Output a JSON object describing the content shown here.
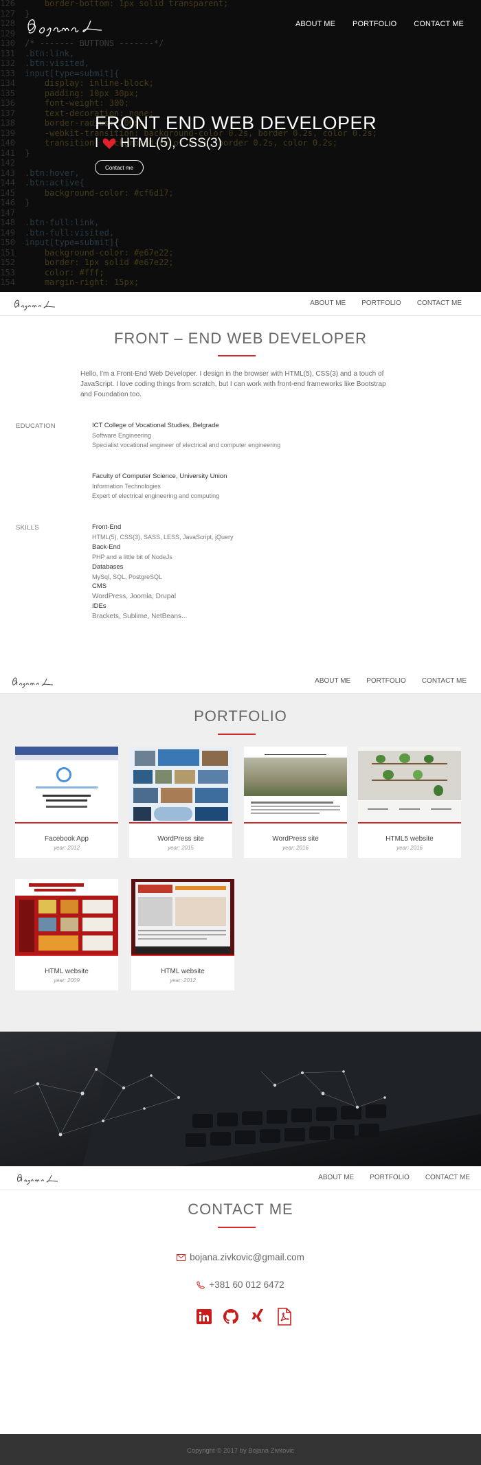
{
  "hero": {
    "nav": [
      "ABOUT ME",
      "PORTFOLIO",
      "CONTACT ME"
    ],
    "title": "FRONT END WEB DEVELOPER",
    "subtitle_prefix": "I",
    "subtitle_rest": "HTML(5), CSS(3)",
    "button": "Contact me",
    "code_lines": [
      {
        "n": "126",
        "t": "    border-bottom: 1px solid transparent;"
      },
      {
        "n": "127",
        "t": "}"
      },
      {
        "n": "128",
        "t": ""
      },
      {
        "n": "129",
        "t": ""
      },
      {
        "n": "130",
        "t": "/* ------- BUTTONS -------*/"
      },
      {
        "n": "131",
        "t": ".btn:link,"
      },
      {
        "n": "132",
        "t": ".btn:visited,"
      },
      {
        "n": "133",
        "t": "input[type=submit]{"
      },
      {
        "n": "134",
        "t": "    display: inline-block;"
      },
      {
        "n": "135",
        "t": "    padding: 10px 30px;"
      },
      {
        "n": "136",
        "t": "    font-weight: 300;"
      },
      {
        "n": "137",
        "t": "    text-decoration: none;"
      },
      {
        "n": "138",
        "t": "    border-radius: 200px;"
      },
      {
        "n": "139",
        "t": "    -webkit-transition: background-color 0.2s, border 0.2s, color 0.2s;"
      },
      {
        "n": "140",
        "t": "    transition: background-color 0.2s, border 0.2s, color 0.2s;"
      },
      {
        "n": "141",
        "t": "}"
      },
      {
        "n": "142",
        "t": ""
      },
      {
        "n": "143",
        "t": ".btn:hover,"
      },
      {
        "n": "144",
        "t": ".btn:active{"
      },
      {
        "n": "145",
        "t": "    background-color: #cf6d17;"
      },
      {
        "n": "146",
        "t": "}"
      },
      {
        "n": "147",
        "t": ""
      },
      {
        "n": "148",
        "t": ".btn-full:link,"
      },
      {
        "n": "149",
        "t": ".btn-full:visited,"
      },
      {
        "n": "150",
        "t": "input[type=submit]{"
      },
      {
        "n": "151",
        "t": "    background-color: #e67e22;"
      },
      {
        "n": "152",
        "t": "    border: 1px solid #e67e22;"
      },
      {
        "n": "153",
        "t": "    color: #fff;"
      },
      {
        "n": "154",
        "t": "    margin-right: 15px;"
      }
    ]
  },
  "nav": [
    "ABOUT ME",
    "PORTFOLIO",
    "CONTACT ME"
  ],
  "about": {
    "title": "FRONT – END WEB DEVELOPER",
    "intro": "Hello, I'm a Front-End Web Developer. I design in the browser with HTML(5), CSS(3) and a touch of JavaScript. I love coding things from scratch, but I can work with front-end frameworks like Bootstrap and Foundation too.",
    "education_label": "EDUCATION",
    "education": [
      {
        "title": "ICT College of Vocational Studies, Belgrade",
        "line1": "Software Engineering",
        "line2": "Specialist vocational engineer of electrical and computer engineering"
      },
      {
        "title": "Faculty of Computer Science, University Union",
        "line1": "Information Technologies",
        "line2": "Expert of electrical engineering and computing"
      }
    ],
    "skills_label": "SKILLS",
    "skills": [
      {
        "head": "Front-End",
        "detail": "HTML(5), CSS(3), SASS, LESS, JavaScript, jQuery"
      },
      {
        "head": "Back-End",
        "detail": "PHP and a little bit of NodeJs"
      },
      {
        "head": "Databases",
        "detail": "MySql, SQL, PostgreSQL"
      },
      {
        "head": "CMS",
        "detail": "WordPress, Joomla, Drupal"
      },
      {
        "head": "IDEs",
        "detail": "Brackets, Sublime, NetBeans..."
      }
    ]
  },
  "portfolio": {
    "title": "PORTFOLIO",
    "items": [
      {
        "title": "Facebook App",
        "year": "year: 2012"
      },
      {
        "title": "WordPress site",
        "year": "year: 2015"
      },
      {
        "title": "WordPress site",
        "year": "year: 2016"
      },
      {
        "title": "HTML5 website",
        "year": "year: 2016"
      },
      {
        "title": "HTML website",
        "year": "year: 2009"
      },
      {
        "title": "HTML website",
        "year": "year: 2012"
      }
    ]
  },
  "contact": {
    "title": "CONTACT ME",
    "email": "bojana.zivkovic@gmail.com",
    "phone": "+381 60 012 6472",
    "socials": [
      "linkedin-icon",
      "github-icon",
      "xing-icon",
      "pdf-icon"
    ]
  },
  "footer": {
    "text": "Copyright © 2017 by Bojana Zivkovic"
  },
  "colors": {
    "accent": "#d52b2b",
    "dark": "#141414",
    "footer": "#333333",
    "portfolio_bg": "#efefef"
  }
}
